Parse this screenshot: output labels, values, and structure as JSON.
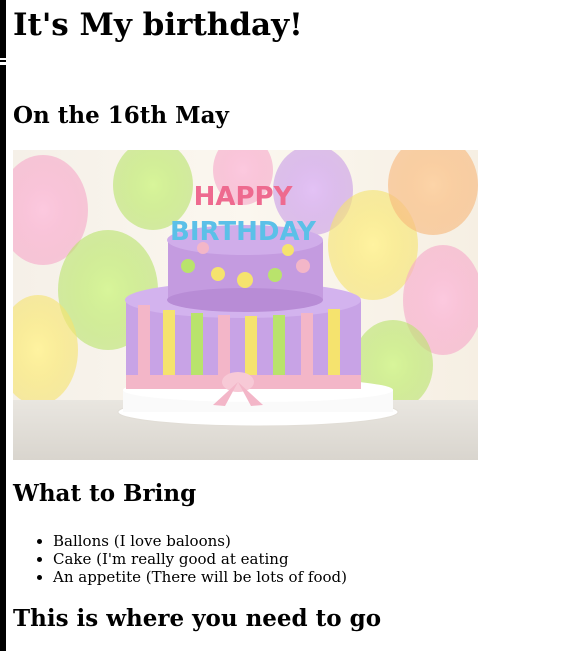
{
  "page": {
    "title": "It's My birthday!",
    "date_heading": "On the 16th May",
    "bring_heading": "What to Bring",
    "bring_items": [
      "Ballons (I love baloons)",
      "Cake (I'm really good at eating",
      "An appetite (There will be lots of food)"
    ],
    "where_heading": "This is where you need to go",
    "photo": {
      "cake_text_top": "HAPPY",
      "cake_text_bottom": "BIRTHDAY"
    }
  },
  "colors": {
    "cake_top": "#c49be0",
    "cake_bottom": "#c8a3e6",
    "ribbon": "#f3b6c8",
    "balloon_green": "#b9e36c",
    "balloon_yellow": "#f5e36e",
    "balloon_pink": "#f6a8c9",
    "balloon_orange": "#f7b77a"
  }
}
